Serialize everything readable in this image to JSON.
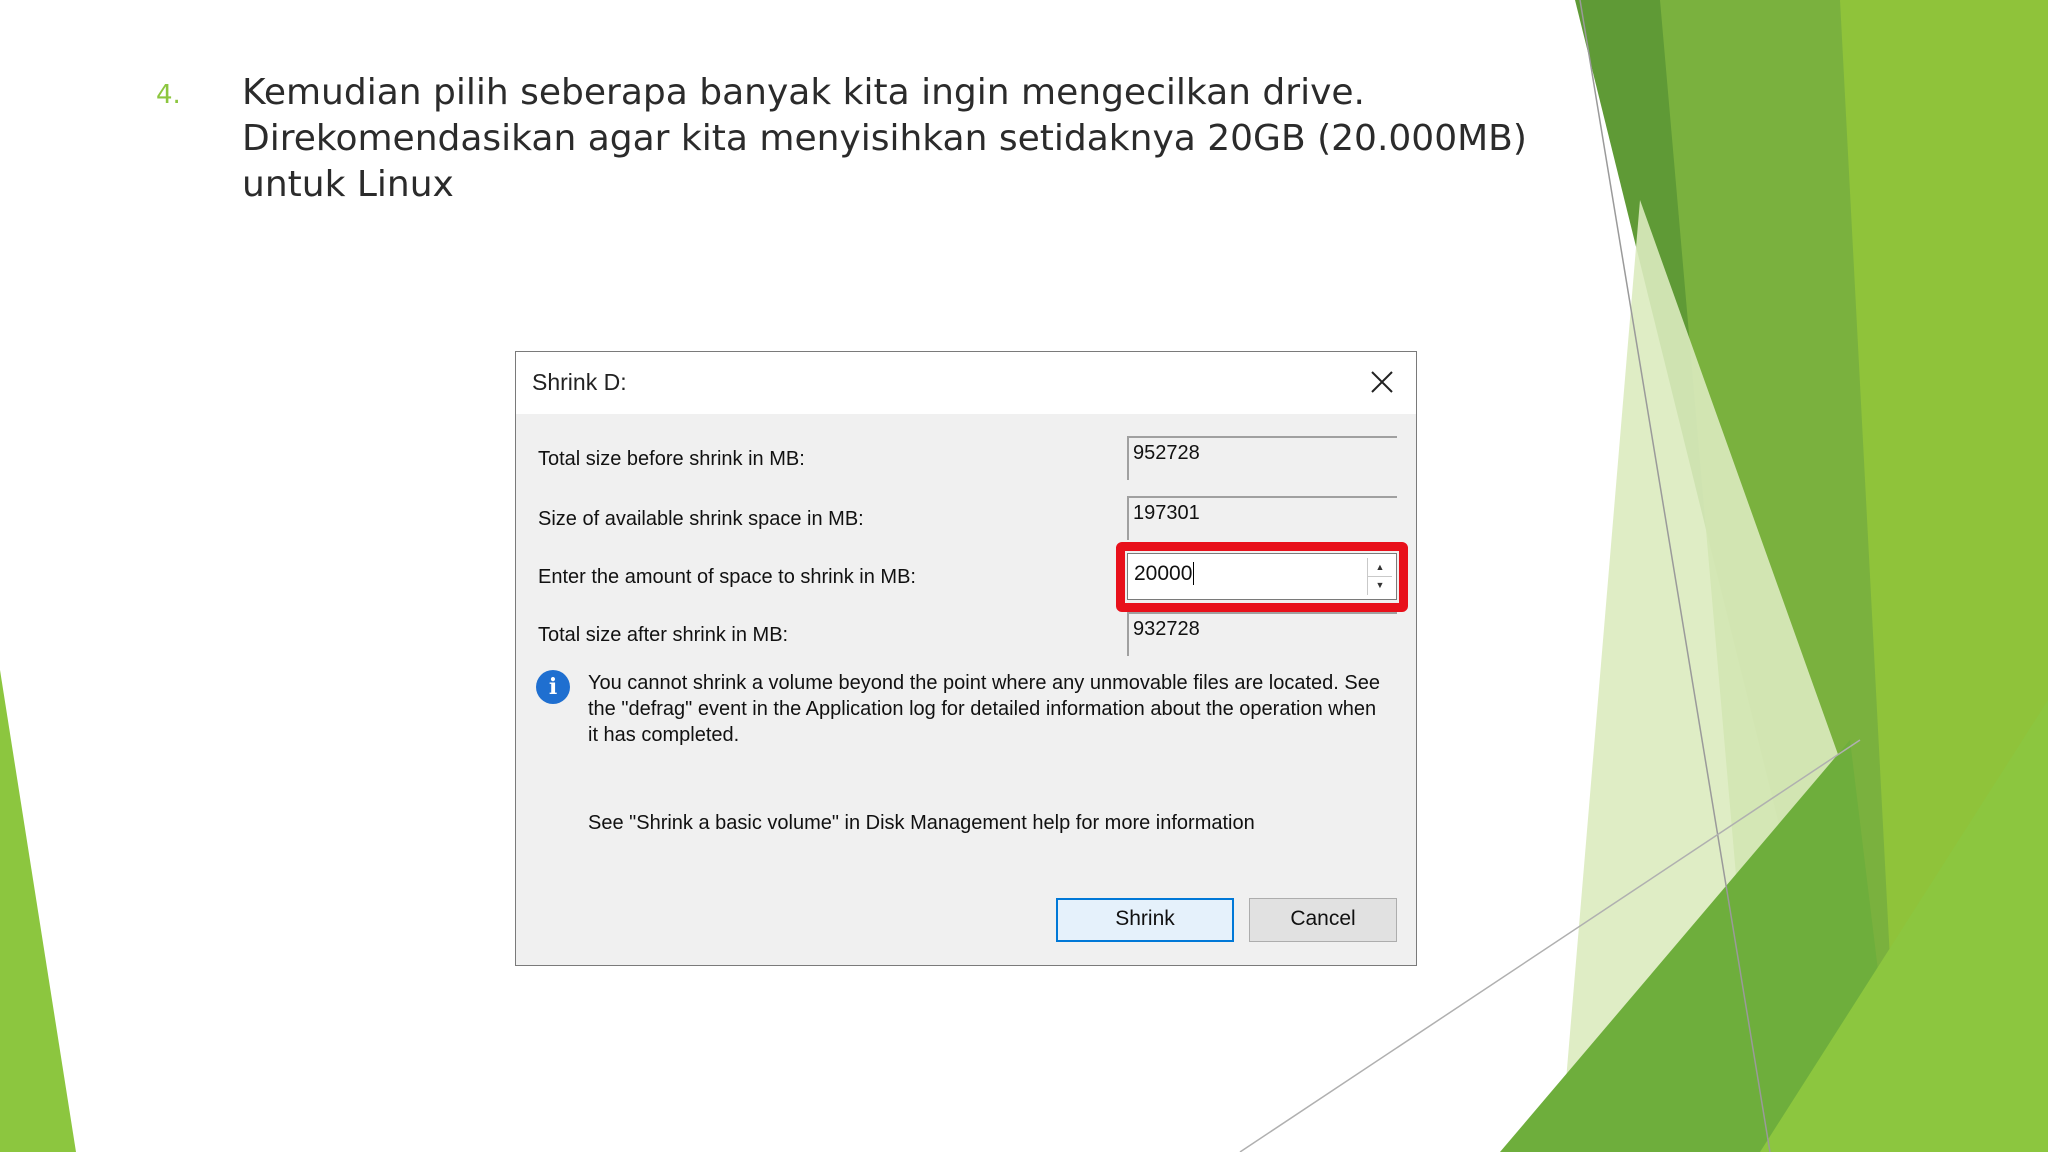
{
  "slide": {
    "number": "4.",
    "paragraph": "Kemudian pilih seberapa banyak kita ingin mengecilkan drive. Direkomendasikan agar kita menyisihkan setidaknya 20GB (20.000MB) untuk Linux"
  },
  "dialog": {
    "title": "Shrink D:",
    "close_icon": "close-icon",
    "rows": [
      {
        "label": "Total size before shrink in MB:",
        "value": "952728"
      },
      {
        "label": "Size of available shrink space in MB:",
        "value": "197301"
      },
      {
        "label": "Enter the amount of space to shrink in MB:",
        "value": "20000"
      },
      {
        "label": "Total size after shrink in MB:",
        "value": "932728"
      }
    ],
    "info_icon": "info-icon",
    "info_text": "You cannot shrink a volume beyond the point where any unmovable files are located. See the \"defrag\" event in the Application log for detailed information about the operation when it has completed.",
    "help_text": "See \"Shrink a basic volume\" in Disk Management help for more information",
    "shrink_label": "Shrink",
    "cancel_label": "Cancel",
    "highlight_color": "#e8101b"
  },
  "colors": {
    "accent_green": "#8cc63f",
    "dark_green": "#5c9a2e",
    "light_green": "#cfe6a8"
  }
}
